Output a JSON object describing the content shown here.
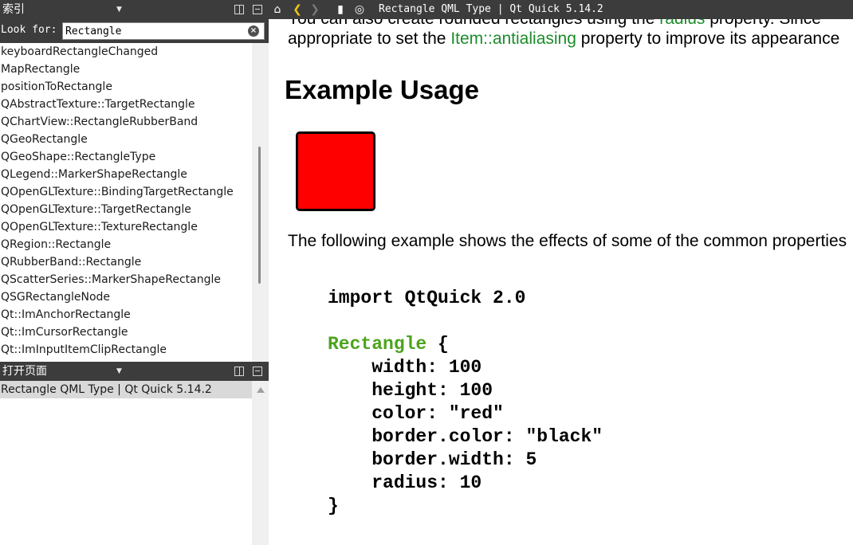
{
  "index_panel": {
    "title": "索引",
    "look_for_label": "Look for:",
    "search_value": "Rectangle",
    "items": [
      "keyboardRectangleChanged",
      "MapRectangle",
      "positionToRectangle",
      "QAbstractTexture::TargetRectangle",
      "QChartView::RectangleRubberBand",
      "QGeoRectangle",
      "QGeoShape::RectangleType",
      "QLegend::MarkerShapeRectangle",
      "QOpenGLTexture::BindingTargetRectangle",
      "QOpenGLTexture::TargetRectangle",
      "QOpenGLTexture::TextureRectangle",
      "QRegion::Rectangle",
      "QRubberBand::Rectangle",
      "QScatterSeries::MarkerShapeRectangle",
      "QSGRectangleNode",
      "Qt::ImAnchorRectangle",
      "Qt::ImCursorRectangle",
      "Qt::ImInputItemClipRectangle"
    ]
  },
  "open_pages_panel": {
    "title": "打开页面",
    "items": [
      "Rectangle QML Type | Qt Quick 5.14.2"
    ]
  },
  "toolbar": {
    "doc_title": "Rectangle QML Type | Qt Quick 5.14.2"
  },
  "content": {
    "para_top_1_a": "You can also create rounded rectangles using the ",
    "para_top_1_link": "radius",
    "para_top_1_b": " property. Since",
    "para_top_2_a": "appropriate to set the ",
    "para_top_2_link": "Item::antialiasing",
    "para_top_2_b": " property to improve its appearance",
    "heading": "Example Usage",
    "para_example": "The following example shows the effects of some of the common properties",
    "code": {
      "import_line": "import QtQuick 2.0",
      "type_name": "Rectangle",
      "open_brace": " {",
      "props": [
        "    width: 100",
        "    height: 100",
        "    color: \"red\"",
        "    border.color: \"black\"",
        "    border.width: 5",
        "    radius: 10"
      ],
      "close_brace": "}"
    }
  },
  "colors": {
    "link": "#1b8c2a",
    "keyword": "#4ba41c",
    "rect_fill": "#ff0000",
    "dark_bar": "#3c3c3c"
  }
}
